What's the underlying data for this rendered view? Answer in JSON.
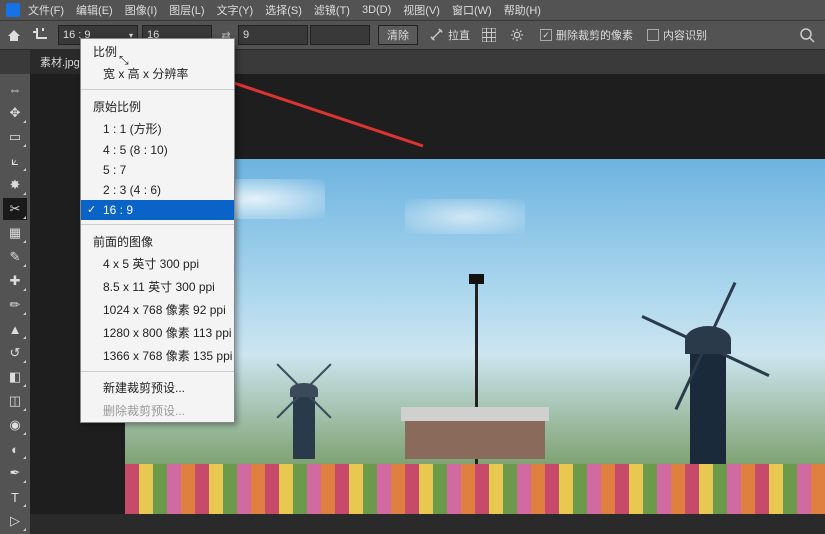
{
  "menu": {
    "items": [
      "文件(F)",
      "编辑(E)",
      "图像(I)",
      "图层(L)",
      "文字(Y)",
      "选择(S)",
      "滤镜(T)",
      "3D(D)",
      "视图(V)",
      "窗口(W)",
      "帮助(H)"
    ]
  },
  "options": {
    "preset_value": "16 : 9",
    "width_value": "16",
    "height_value": "9",
    "res_value": "",
    "clear_label": "清除",
    "straighten_label": "拉直",
    "delete_pixels_label": "删除裁剪的像素",
    "content_aware_label": "内容识别",
    "delete_checked": true,
    "content_checked": false
  },
  "tab": {
    "title": "素材.jpg @"
  },
  "dropdown": {
    "group_ratio": "比例",
    "wxh": "宽 x 高 x 分辨率",
    "group_original": "原始比例",
    "ratios": [
      "1 : 1  (方形)",
      "4 : 5  (8 : 10)",
      "5 : 7",
      "2 : 3  (4 : 6)",
      "16 : 9"
    ],
    "group_front": "前面的图像",
    "presets": [
      "4 x 5 英寸 300 ppi",
      "8.5 x 11 英寸 300 ppi",
      "1024 x 768 像素 92 ppi",
      "1280 x 800 像素 113 ppi",
      "1366 x 768 像素 135 ppi"
    ],
    "new_preset": "新建裁剪预设...",
    "del_preset": "删除裁剪预设...",
    "selected_index": 4
  }
}
